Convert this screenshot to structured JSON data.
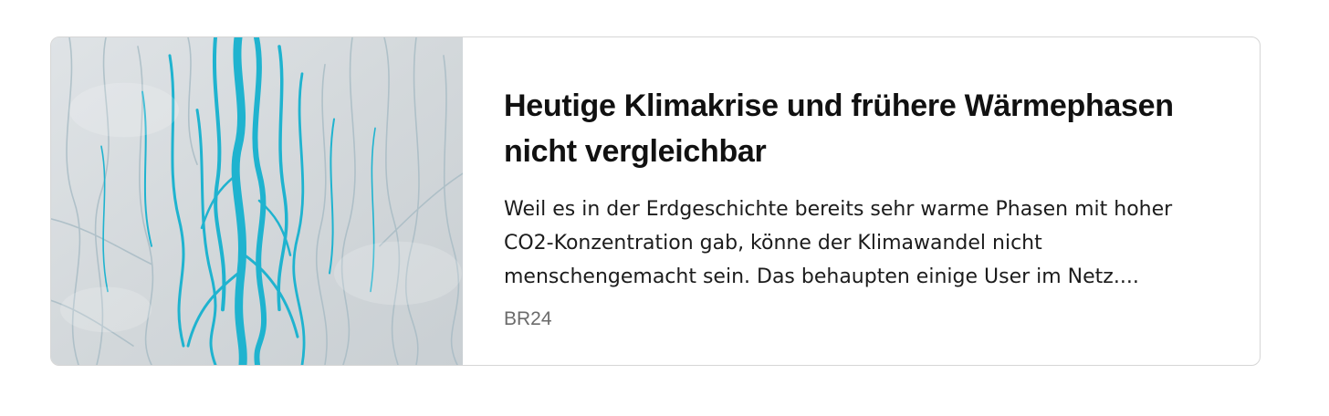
{
  "card": {
    "title": "Heutige Klimakrise und frühere Wärmephasen nicht vergleichbar",
    "description": "Weil es in der Erdgeschichte bereits sehr warme Phasen mit hoher CO2-Konzentration gab, könne der Klimawandel nicht menschengemacht sein. Das behaupten einige User im Netz....",
    "source": "BR24",
    "image": {
      "icon": "glacier-meltwater-rivers-aerial-photo",
      "colors": {
        "ice": "#d5dadd",
        "water": "#1fb3cf",
        "channel_shadow": "#9fb6c0"
      }
    }
  }
}
